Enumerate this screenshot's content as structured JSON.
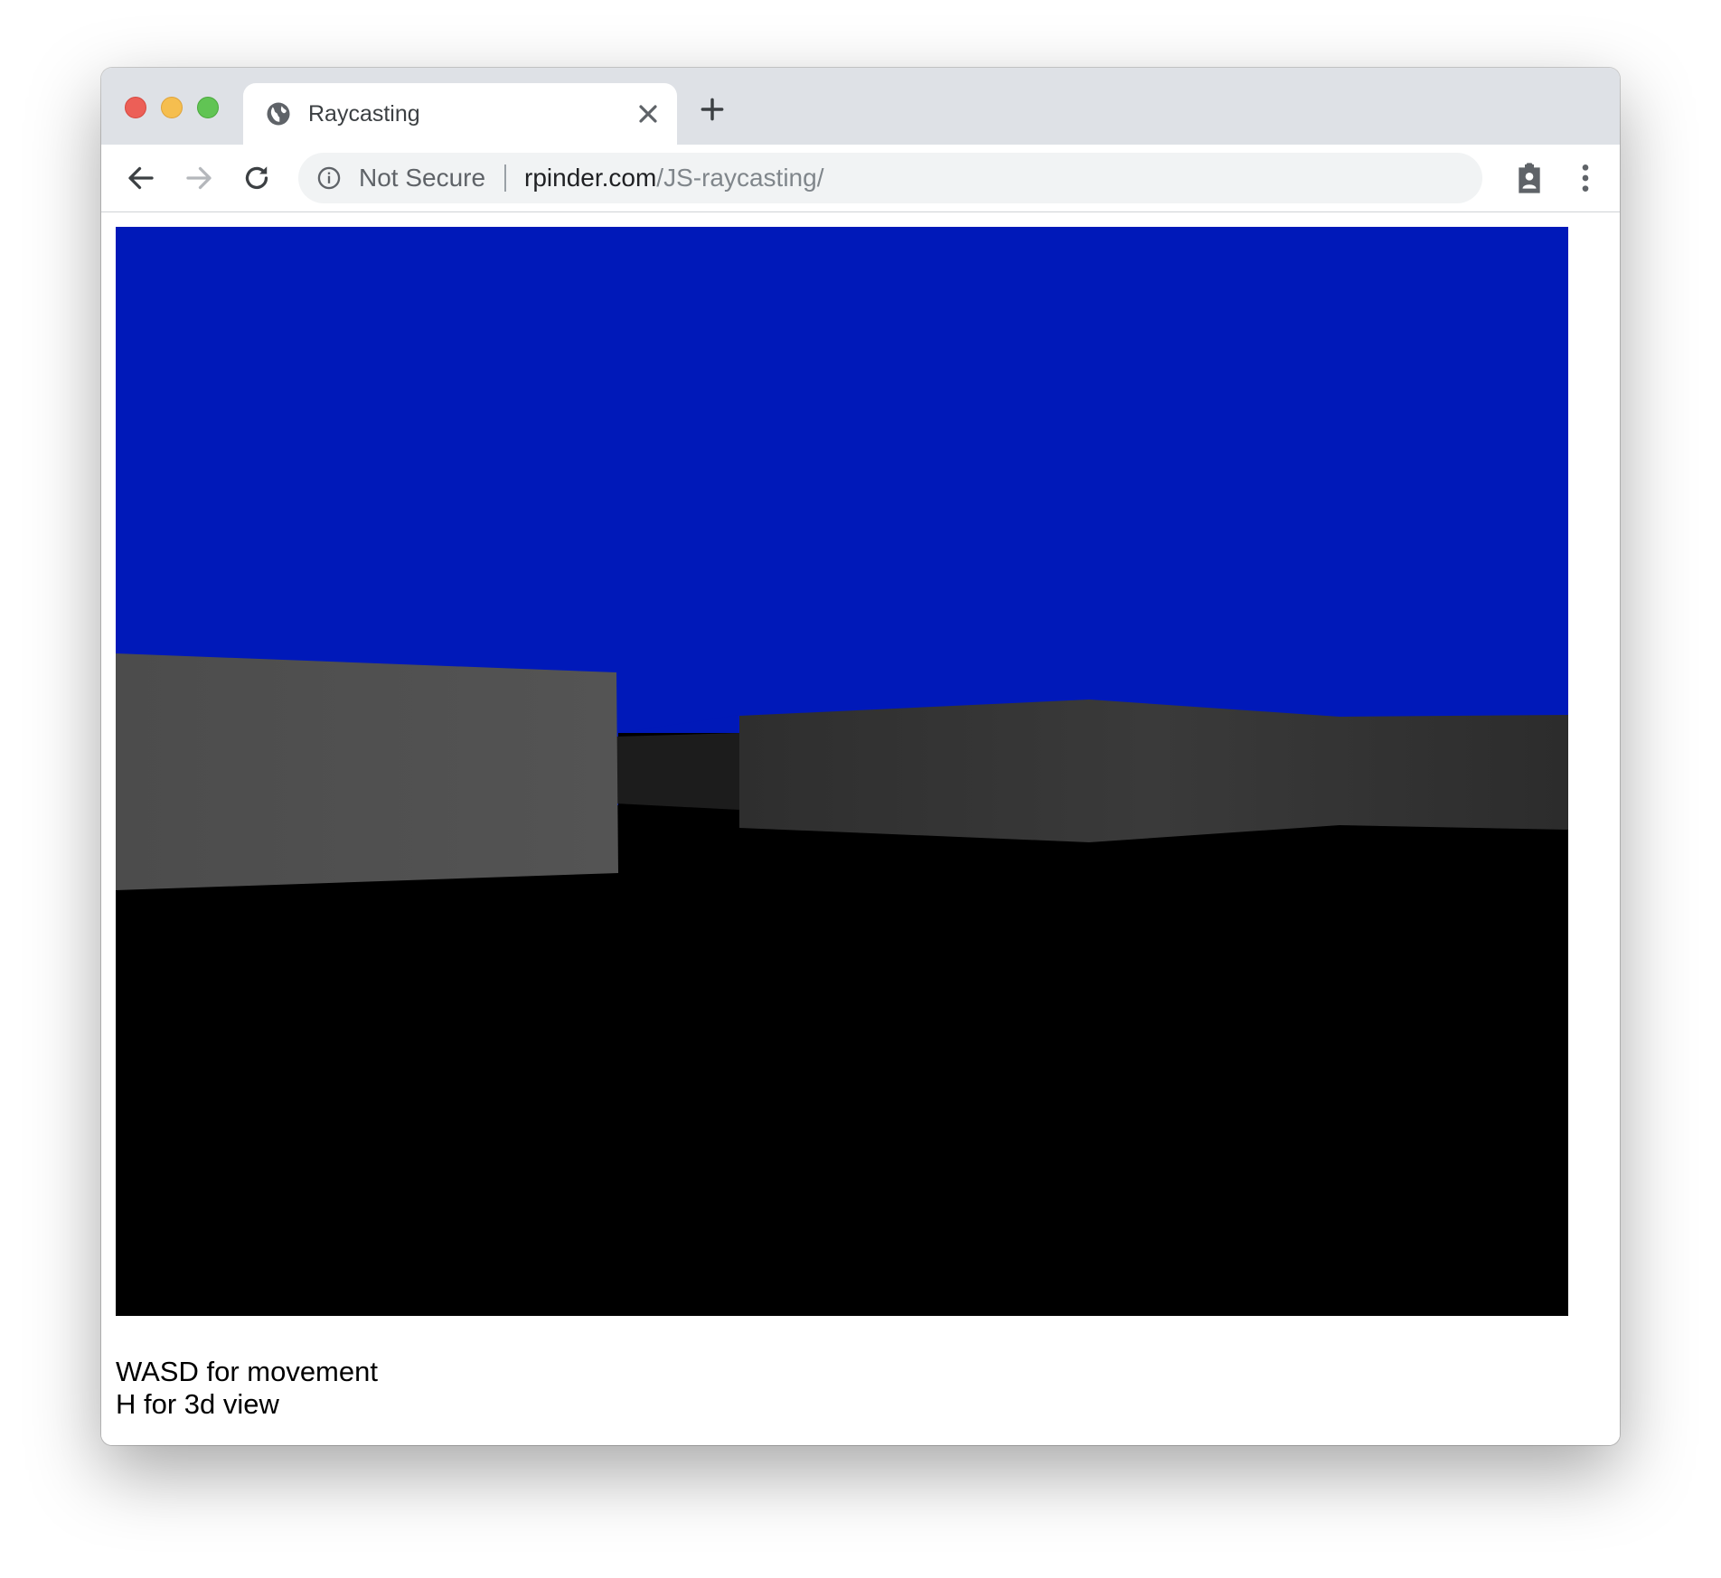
{
  "browser": {
    "tab": {
      "title": "Raycasting",
      "icon": "globe-icon"
    },
    "new_tab_icon": "plus-icon",
    "close_tab_icon": "close-icon",
    "toolbar": {
      "back_icon": "back-arrow-icon",
      "forward_icon": "forward-arrow-icon",
      "reload_icon": "reload-icon",
      "security_icon": "info-icon",
      "security_label": "Not Secure",
      "url_host": "rpinder.com",
      "url_path": "/JS-raycasting/",
      "extension_icon": "clipboard-person-icon",
      "menu_icon": "more-vert-icon"
    },
    "window_controls": [
      "close",
      "minimize",
      "zoom"
    ]
  },
  "page": {
    "instructions": [
      "WASD for movement",
      "H for 3d view"
    ]
  },
  "colors": {
    "sky": "#0019b9",
    "floor": "#000000",
    "wall_near": "#515151",
    "wall_mid": "#383838",
    "wall_dark": "#1c1c1c"
  }
}
